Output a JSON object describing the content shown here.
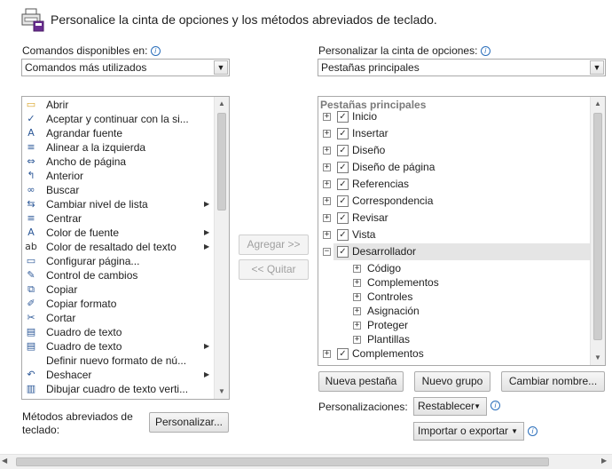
{
  "header": {
    "title": "Personalice la cinta de opciones y los métodos abreviados de teclado."
  },
  "left": {
    "label": "Comandos disponibles en:",
    "combo_value": "Comandos más utilizados",
    "items": [
      {
        "label": "Abrir",
        "icon": "folder-icon",
        "submenu": false
      },
      {
        "label": "Aceptar y continuar con la si...",
        "icon": "accept-change-icon",
        "submenu": false
      },
      {
        "label": "Agrandar fuente",
        "icon": "grow-font-icon",
        "submenu": false
      },
      {
        "label": "Alinear a la izquierda",
        "icon": "align-left-icon",
        "submenu": false
      },
      {
        "label": "Ancho de página",
        "icon": "page-width-icon",
        "submenu": false
      },
      {
        "label": "Anterior",
        "icon": "previous-icon",
        "submenu": false
      },
      {
        "label": "Buscar",
        "icon": "binoculars-icon",
        "submenu": false
      },
      {
        "label": "Cambiar nivel de lista",
        "icon": "list-level-icon",
        "submenu": true
      },
      {
        "label": "Centrar",
        "icon": "align-center-icon",
        "submenu": false
      },
      {
        "label": "Color de fuente",
        "icon": "font-color-icon",
        "submenu": true
      },
      {
        "label": "Color de resaltado del texto",
        "icon": "highlight-icon",
        "submenu": true
      },
      {
        "label": "Configurar página...",
        "icon": "page-setup-icon",
        "submenu": false
      },
      {
        "label": "Control de cambios",
        "icon": "track-changes-icon",
        "submenu": false
      },
      {
        "label": "Copiar",
        "icon": "copy-icon",
        "submenu": false
      },
      {
        "label": "Copiar formato",
        "icon": "format-painter-icon",
        "submenu": false
      },
      {
        "label": "Cortar",
        "icon": "scissors-icon",
        "submenu": false
      },
      {
        "label": "Cuadro de texto",
        "icon": "text-box-icon",
        "submenu": false
      },
      {
        "label": "Cuadro de texto",
        "icon": "text-box-icon",
        "submenu": true
      },
      {
        "label": "Definir nuevo formato de nú...",
        "icon": "",
        "submenu": false
      },
      {
        "label": "Deshacer",
        "icon": "undo-icon",
        "submenu": true
      },
      {
        "label": "Dibujar cuadro de texto verti...",
        "icon": "vertical-text-box-icon",
        "submenu": false
      }
    ]
  },
  "middle": {
    "add_label": "Agregar >>",
    "remove_label": "<< Quitar"
  },
  "right": {
    "label": "Personalizar la cinta de opciones:",
    "combo_value": "Pestañas principales",
    "list_header": "Pestañas principales",
    "tabs": [
      {
        "label": "Inicio",
        "expander": "+"
      },
      {
        "label": "Insertar",
        "expander": "+"
      },
      {
        "label": "Diseño",
        "expander": "+"
      },
      {
        "label": "Diseño de página",
        "expander": "+"
      },
      {
        "label": "Referencias",
        "expander": "+"
      },
      {
        "label": "Correspondencia",
        "expander": "+"
      },
      {
        "label": "Revisar",
        "expander": "+"
      },
      {
        "label": "Vista",
        "expander": "+"
      },
      {
        "label": "Desarrollador",
        "expander": "−"
      }
    ],
    "groups": [
      "Código",
      "Complementos",
      "Controles",
      "Asignación",
      "Proteger",
      "Plantillas"
    ],
    "after": {
      "label": "Complementos",
      "expander": "+"
    }
  },
  "buttons": {
    "new_tab": "Nueva pestaña",
    "new_group": "Nuevo grupo",
    "rename": "Cambiar nombre...",
    "personalizations_label": "Personalizaciones:",
    "reset": "Restablecer",
    "import_export": "Importar o exportar"
  },
  "shortcuts": {
    "label_line1": "Métodos abreviados de",
    "label_line2": "teclado:",
    "button": "Personalizar..."
  },
  "colors": {
    "selected_row": "#e5e5e5",
    "accent": "#2a6ebb",
    "header_text": "#7a7a7a"
  }
}
